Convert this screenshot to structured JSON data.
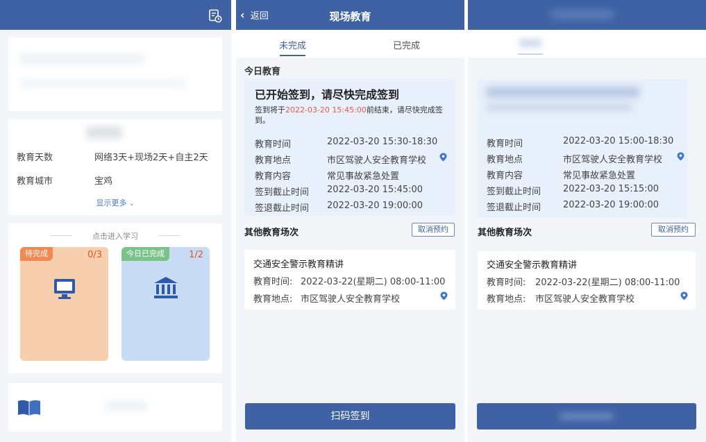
{
  "panel1": {
    "header_icon": "document-clock-icon",
    "info": [
      {
        "label": "教育天数",
        "value": "网络3天+现场2天+自主2天"
      },
      {
        "label": "教育城市",
        "value": "宝鸡"
      }
    ],
    "show_more": "显示更多",
    "study_entry": "点击进入学习",
    "tiles": [
      {
        "tag": "待完成",
        "count": "0/3",
        "icon": "monitor-icon",
        "color": "#f7cfaf",
        "tag_color": "#f08a52",
        "count_color": "#d05a2a"
      },
      {
        "tag": "今日已完成",
        "count": "1/2",
        "icon": "bank-building-icon",
        "color": "#c8dcf5",
        "tag_color": "#7ac28a",
        "count_color": "#d05a2a"
      }
    ],
    "bottom_icon": "book-icon"
  },
  "panel2": {
    "back_label": "返回",
    "title": "现场教育",
    "tabs": [
      "未完成",
      "已完成"
    ],
    "today_title": "今日教育",
    "sign_title": "已开始签到，请尽快完成签到",
    "notice_prefix": "签到将于",
    "notice_time": "2022-03-20 15:45:00",
    "notice_suffix": "前结束，请尽快完成签到。",
    "details": [
      {
        "label": "教育时间",
        "value": "2022-03-20 15:30-18:30"
      },
      {
        "label": "教育地点",
        "value": "市区驾驶人安全教育学校"
      },
      {
        "label": "教育内容",
        "value": "常见事故紧急处置"
      },
      {
        "label": "签到截止时间",
        "value": "2022-03-20 15:45:00"
      },
      {
        "label": "签退截止时间",
        "value": "2022-03-20 19:00:00"
      }
    ],
    "other_title": "其他教育场次",
    "cancel_label": "取消预约",
    "session_title": "交通安全警示教育精讲",
    "session_rows": [
      {
        "label": "教育时间:",
        "value": "2022-03-22(星期二) 08:00-11:00"
      },
      {
        "label": "教育地点:",
        "value": "市区驾驶人安全教育学校"
      }
    ],
    "scan_button": "扫码签到",
    "accent": "#3f62a4"
  },
  "panel3": {
    "details": [
      {
        "label": "教育时间",
        "value": "2022-03-20 15:00-18:30"
      },
      {
        "label": "教育地点",
        "value": "市区驾驶人安全教育学校"
      },
      {
        "label": "教育内容",
        "value": "常见事故紧急处置"
      },
      {
        "label": "签到截止时间",
        "value": "2022-03-20 15:15:00"
      },
      {
        "label": "签退截止时间",
        "value": "2022-03-20 19:00:00"
      }
    ],
    "other_title": "其他教育场次",
    "cancel_label": "取消预约",
    "session_title": "交通安全警示教育精讲",
    "session_rows": [
      {
        "label": "教育时间:",
        "value": "2022-03-22(星期二) 08:00-11:00"
      },
      {
        "label": "教育地点:",
        "value": "市区驾驶人安全教育学校"
      }
    ]
  }
}
